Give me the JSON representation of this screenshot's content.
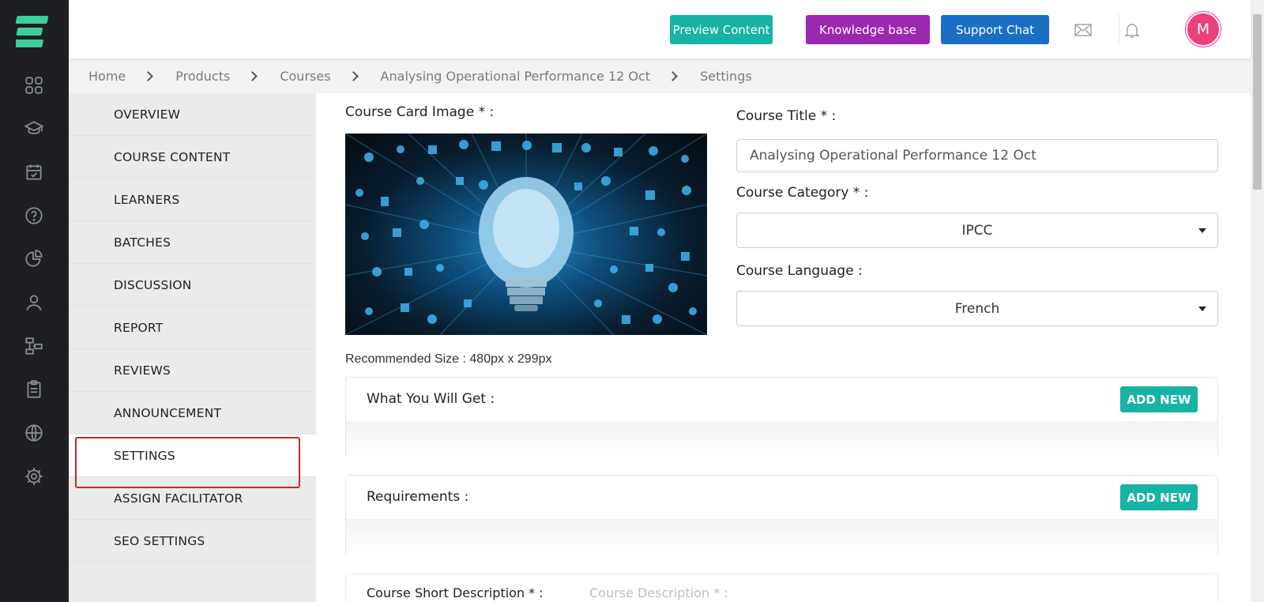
{
  "rail": {
    "icons": [
      "dashboard-icon",
      "graduation-cap-icon",
      "calendar-check-icon",
      "help-circle-icon",
      "pie-chart-icon",
      "user-icon",
      "flow-icon",
      "clipboard-icon",
      "globe-icon",
      "settings-icon"
    ]
  },
  "header": {
    "preview_label": "Preview Content",
    "kb_label": "Knowledge base",
    "support_label": "Support Chat",
    "avatar_letter": "M",
    "colors": {
      "preview": "#17b3a3",
      "knowledge_base": "#9c27b0",
      "support": "#1a6fc4",
      "avatar": "#ec407a"
    }
  },
  "breadcrumb": [
    "Home",
    "Products",
    "Courses",
    "Analysing Operational Performance 12 Oct",
    "Settings"
  ],
  "menu": {
    "items": [
      "OVERVIEW",
      "COURSE CONTENT",
      "LEARNERS",
      "BATCHES",
      "DISCUSSION",
      "REPORT",
      "REVIEWS",
      "ANNOUNCEMENT",
      "SETTINGS",
      "ASSIGN FACILITATOR",
      "SEO SETTINGS"
    ],
    "active": "SETTINGS"
  },
  "form": {
    "card_image_label": "Course Card Image * :",
    "recommended_size": "Recommended Size : 480px x 299px",
    "title_label": "Course Title * :",
    "title_value": "Analysing Operational Performance 12 Oct",
    "category_label": "Course Category * :",
    "category_value": "IPCC",
    "language_label": "Course Language :",
    "language_value": "French"
  },
  "sections": {
    "what_you_get": {
      "title": "What You Will Get :",
      "button": "ADD NEW"
    },
    "requirements": {
      "title": "Requirements :",
      "button": "ADD NEW"
    },
    "tabs": [
      "Course Short Description * :",
      "Course Description * :"
    ]
  }
}
